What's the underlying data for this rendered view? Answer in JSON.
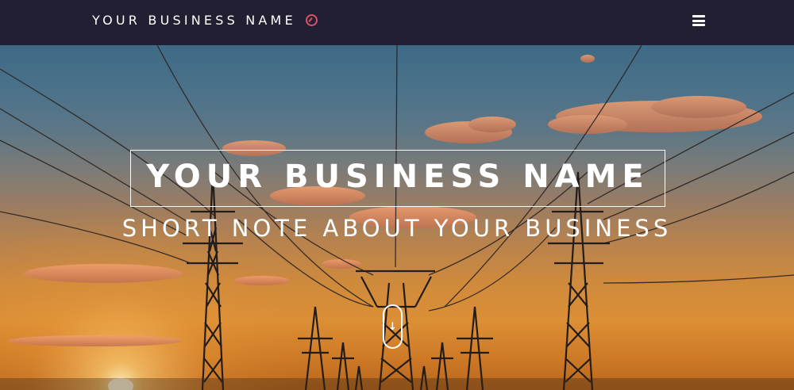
{
  "nav": {
    "brand": "YOUR BUSINESS NAME",
    "brand_icon": "compass-icon",
    "menu_icon": "hamburger-menu-icon"
  },
  "hero": {
    "title": "YOUR BUSINESS NAME",
    "subtitle": "SHORT NOTE ABOUT YOUR BUSINESS",
    "scroll_icon": "scroll-down-arrow-icon",
    "scroll_glyph": "↓",
    "background": "sunset-power-lines-photo"
  },
  "colors": {
    "navbar": "#231f33",
    "accent": "#d9506a",
    "text": "#ffffff"
  }
}
